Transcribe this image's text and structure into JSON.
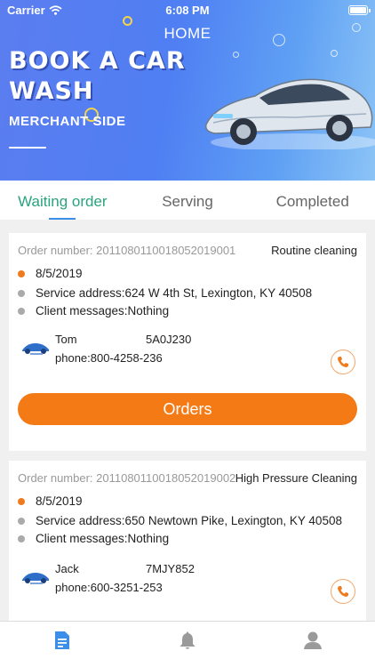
{
  "status_bar": {
    "carrier": "Carrier",
    "time": "6:08 PM"
  },
  "header": {
    "title": "HOME",
    "headline_line1": "BOOK A CAR",
    "headline_line2": "WASH",
    "subheadline": "MERCHANT SIDE"
  },
  "tabs": [
    {
      "label": "Waiting order",
      "active": true
    },
    {
      "label": "Serving",
      "active": false
    },
    {
      "label": "Completed",
      "active": false
    }
  ],
  "orders": [
    {
      "order_number": "Order number: 20110801100180520190​01",
      "service_type": "Routine cleaning",
      "date": "8/5/2019",
      "address": "Service address:624 W 4th St, Lexington, KY 40508",
      "message": "Client messages:Nothing",
      "client_name": "Tom",
      "plate": "5A0J230",
      "phone": "phone:800-4258-236",
      "action_label": "Orders"
    },
    {
      "order_number": "Order number: 20110801100180520190​02",
      "service_type": "High Pressure Cleaning",
      "date": "8/5/2019",
      "address": "Service address:650 Newtown Pike, Lexington, KY 40508",
      "message": "Client messages:Nothing",
      "client_name": "Jack",
      "plate": "7MJY852",
      "phone": "phone:600-3251-253"
    }
  ],
  "bottom_nav": [
    {
      "icon": "document-icon",
      "active": true
    },
    {
      "icon": "bell-icon",
      "active": false
    },
    {
      "icon": "user-icon",
      "active": false
    }
  ],
  "colors": {
    "accent_orange": "#f47a16",
    "active_tab": "#2aa37e",
    "tab_indicator": "#3c8ee8",
    "nav_active": "#3c8ee8",
    "nav_inactive": "#9a9a9a"
  }
}
